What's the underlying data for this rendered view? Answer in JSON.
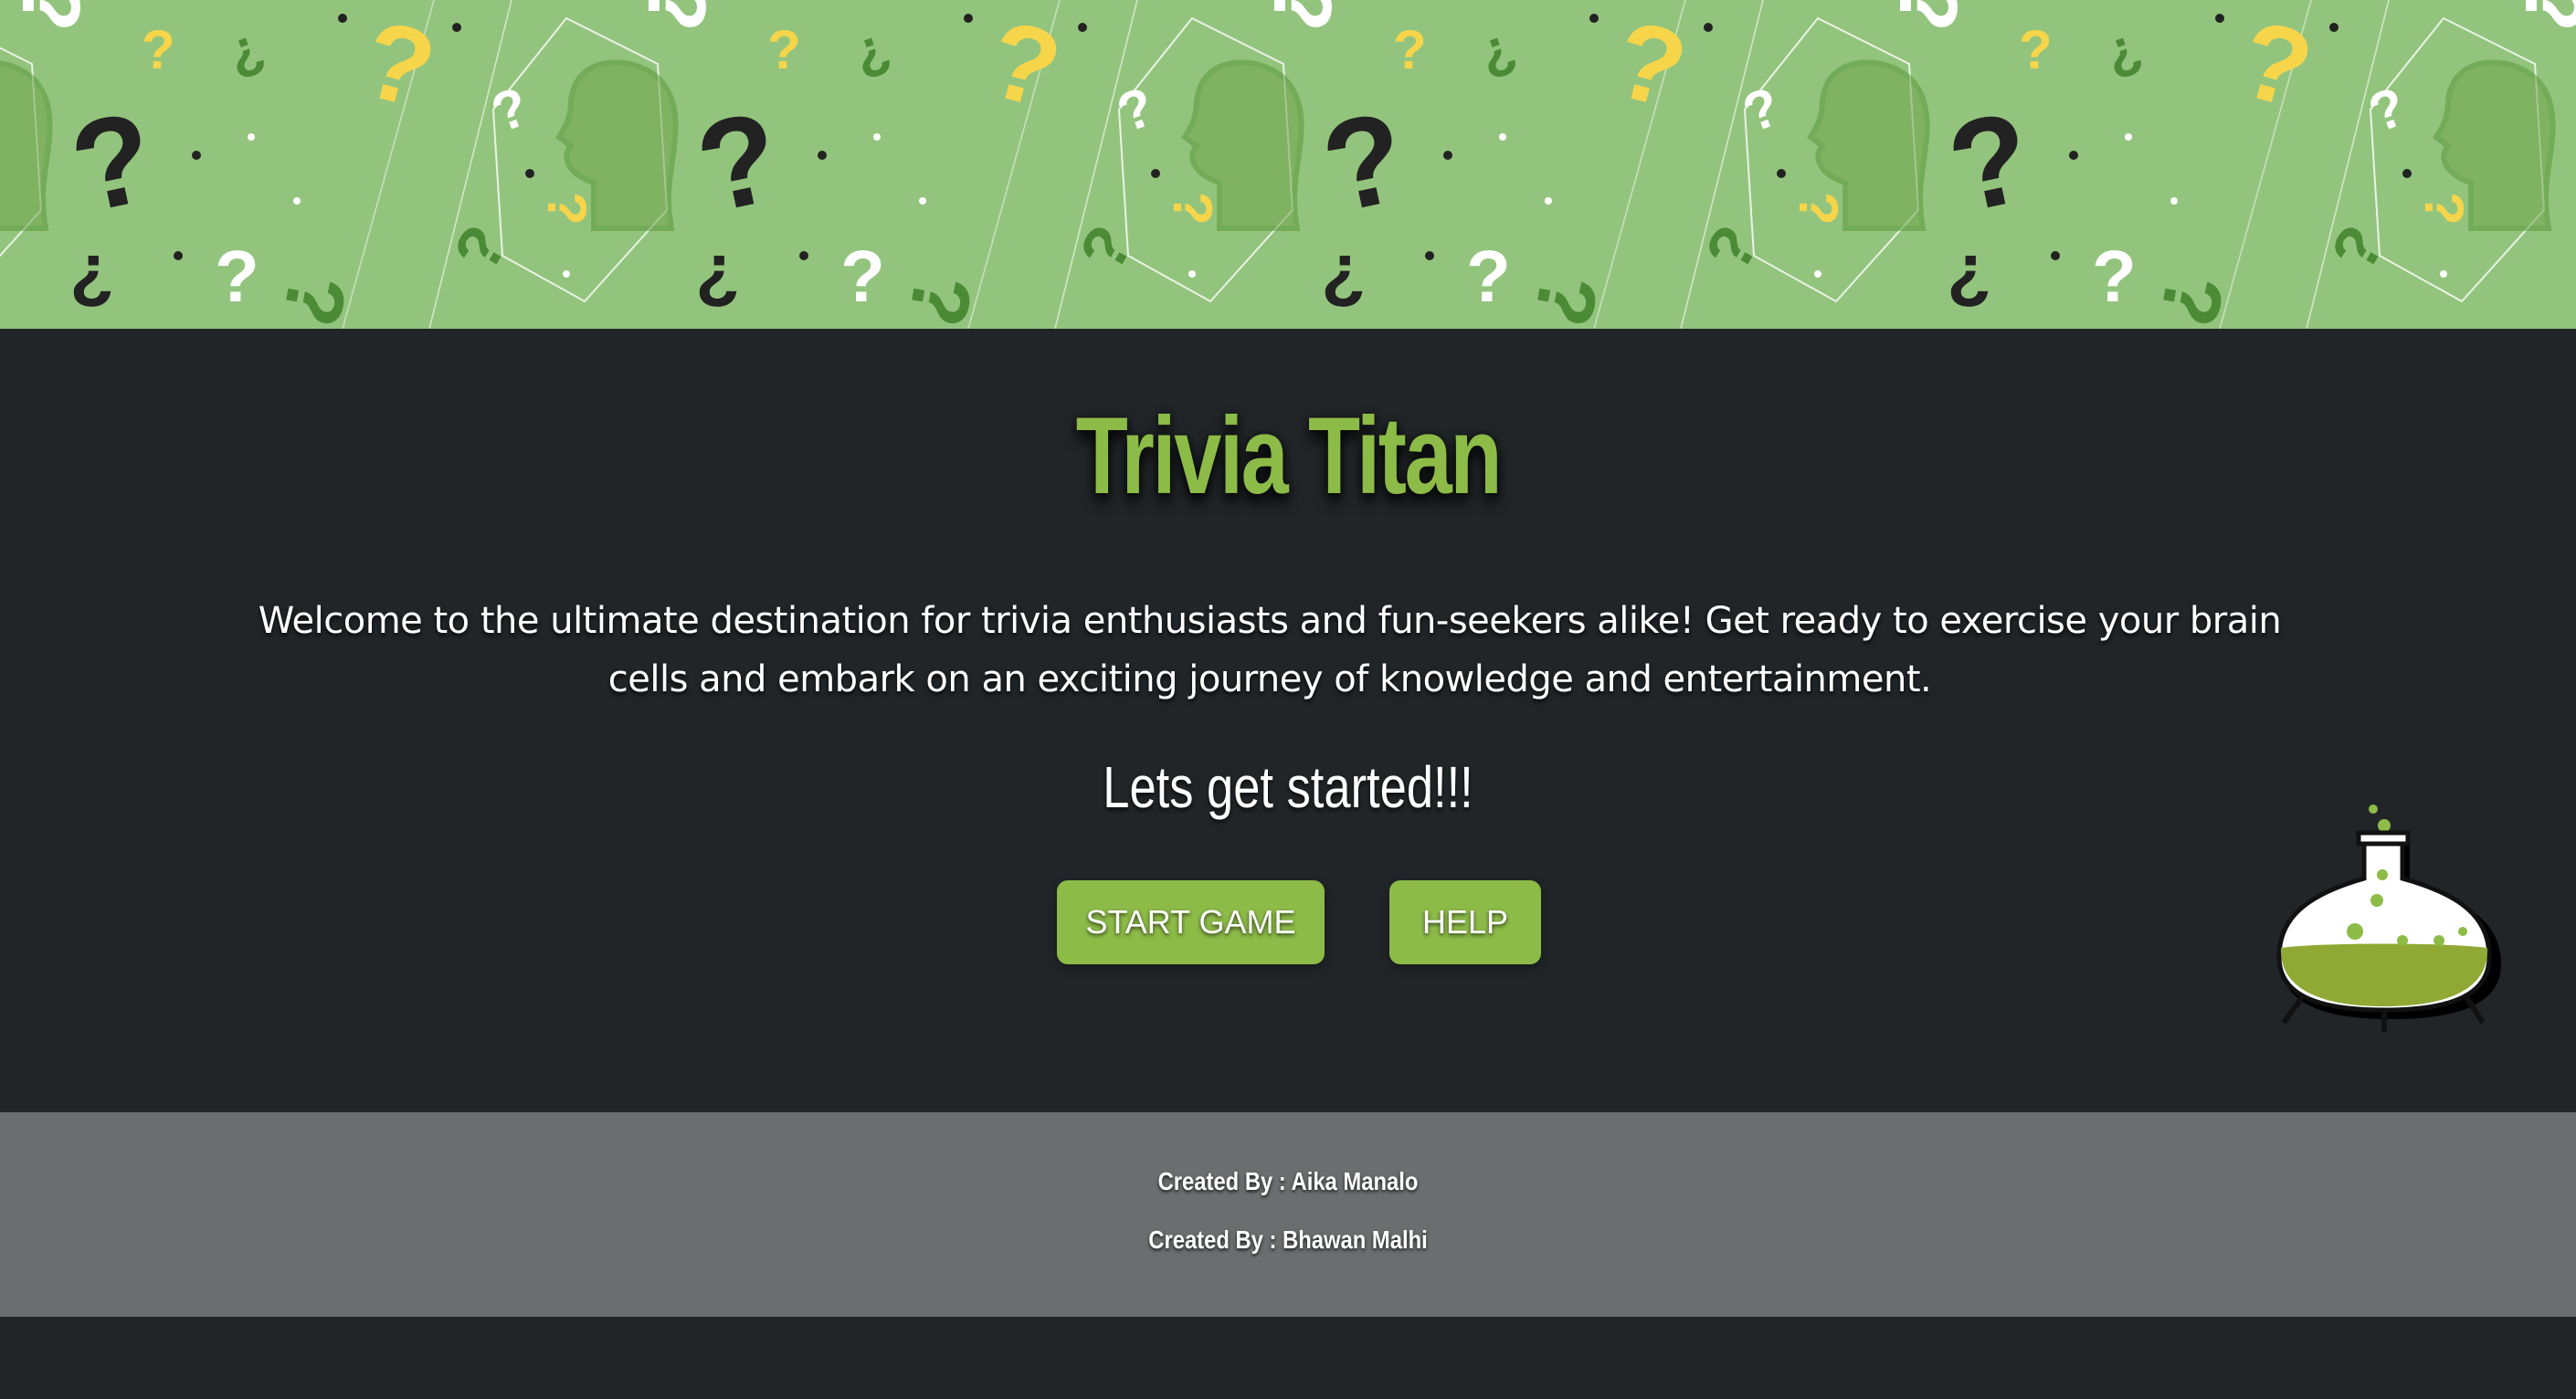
{
  "banner": {
    "pattern_icon": "question-head-pattern",
    "background_color": "#93c47d"
  },
  "main": {
    "title": "Trivia Titan",
    "welcome_text": "Welcome to the ultimate destination for trivia enthusiasts and fun-seekers alike! Get ready to exercise your brain cells and embark on an exciting journey of knowledge and entertainment.",
    "started_text": "Lets get started!!!",
    "start_button": "START GAME",
    "help_button": "HELP",
    "flask_icon": "potion-flask-icon"
  },
  "footer": {
    "credit_1": "Created By : Aika Manalo",
    "credit_2": "Created By : Bhawan Malhi"
  },
  "colors": {
    "accent": "#8dbb48",
    "background": "#212528",
    "footer": "#6b6d6f"
  }
}
